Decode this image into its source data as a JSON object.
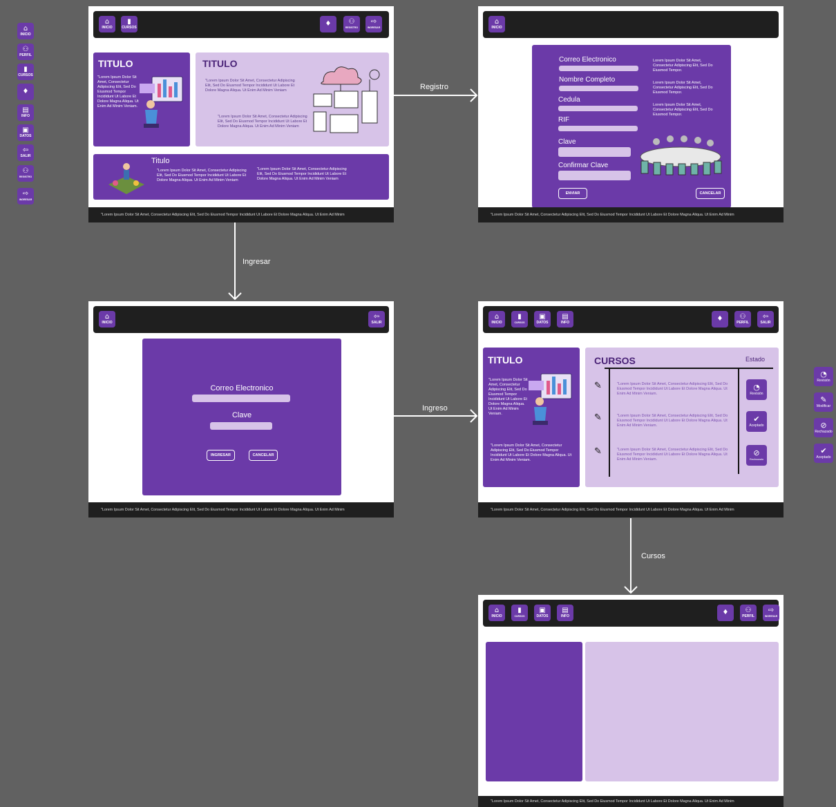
{
  "legend": [
    {
      "icon": "home-icon",
      "glyph": "⌂",
      "label": "INICIO"
    },
    {
      "icon": "user-icon",
      "glyph": "⚇",
      "label": "PERFIL"
    },
    {
      "icon": "book-icon",
      "glyph": "▮",
      "label": "CURSOS"
    },
    {
      "icon": "bell-icon",
      "glyph": "♦",
      "label": ""
    },
    {
      "icon": "document-icon",
      "glyph": "▤",
      "label": "INFO"
    },
    {
      "icon": "folder-icon",
      "glyph": "▣",
      "label": "DATOS"
    },
    {
      "icon": "logout-icon",
      "glyph": "⇦",
      "label": "SALIR"
    },
    {
      "icon": "user-add-icon",
      "glyph": "⚇",
      "label": "REGISTRO"
    },
    {
      "icon": "login-icon",
      "glyph": "⇨",
      "label": "INGRESAR"
    }
  ],
  "status_legend": [
    {
      "icon": "clock-icon",
      "glyph": "◔",
      "label": "Revisión"
    },
    {
      "icon": "wrench-icon",
      "glyph": "✎",
      "label": "Modificar"
    },
    {
      "icon": "ban-icon",
      "glyph": "⊘",
      "label": "Rechazado"
    },
    {
      "icon": "check-icon",
      "glyph": "✔",
      "label": "Aceptado"
    }
  ],
  "arrows": {
    "registro": "Registro",
    "ingresar": "Ingresar",
    "ingreso": "Ingreso",
    "cursos": "Cursos"
  },
  "nav": {
    "inicio": "INICIO",
    "cursos": "CURSOS",
    "datos": "DATOS",
    "info": "INFO",
    "perfil": "PERFIL",
    "salir": "SALIR",
    "registro": "REGISTRO",
    "ingresar": "INGRESAR"
  },
  "footer_text": "\"Lorem Ipsum Dolor Sit Amet, Consectetur Adipiscing Elit, Sed Do Eiusmod Tempor Incididunt Ut Labore Et Dolore Magna Aliqua. Ut Enim Ad Minim",
  "home": {
    "card1_title": "TITULO",
    "card1_text": "\"Lorem Ipsum Dolor Sit Amet, Consectetur Adipiscing Elit, Sed Do Eiusmod Tempor Incididunt Ut Labore Et Dolore Magna Aliqua. Ut Enim Ad Minim Veniam.",
    "card2_title": "TITULO",
    "card2_text1": "\"Lorem Ipsum Dolor Sit Amet, Consectetur Adipiscing Elit, Sed Do Eiusmod Tempor Incididunt Ut Labore Et Dolore Magna Aliqua. Ut Enim Ad Minim Veniam",
    "card2_text2": "\"Lorem Ipsum Dolor Sit Amet, Consectetur Adipiscing Elit, Sed Do Eiusmod Tempor Incididunt Ut Labore Et Dolore Magna Aliqua. Ut Enim Ad Minim Veniam",
    "card3_title": "Titulo",
    "card3_text1": "\"Lorem Ipsum Dolor Sit Amet, Consectetur Adipiscing Elit, Sed Do Eiusmod Tempor Incididunt Ut Labore Et Dolore Magna Aliqua. Ut Enim Ad Minim Veniam",
    "card3_text2": "\"Lorem Ipsum Dolor Sit Amet, Consectetur Adipiscing Elit, Sed Do Eiusmod Tempor Incididunt Ut Labore Et Dolore Magna Aliqua. Ut Enim Ad Minim Veniam"
  },
  "register": {
    "fields": [
      "Correo Electronico",
      "Nombre Completo",
      "Cedula",
      "RIF",
      "Clave",
      "Confirmar Clave"
    ],
    "notes": [
      "Lorem Ipsum Dolor Sit Amet, Consectetur Adipiscing Elit, Sed Do Eiusmod Tempor.",
      "Lorem Ipsum Dolor Sit Amet, Consectetur Adipiscing Elit, Sed Do Eiusmod Tempor.",
      "Lorem Ipsum Dolor Sit Amet, Consectetur Adipiscing Elit, Sed Do Eiusmod Tempor."
    ],
    "submit": "ENVIAR",
    "cancel": "CANCELAR"
  },
  "login": {
    "email": "Correo Electronico",
    "password": "Clave",
    "submit": "INGRESAR",
    "cancel": "CANCELAR"
  },
  "dashboard": {
    "left_title": "TITULO",
    "left_text1": "\"Lorem Ipsum Dolor Sit Amet, Consectetur Adipiscing Elit, Sed Do Eiusmod Tempor Incididunt Ut Labore Et Dolore Magna Aliqua. Ut Enim Ad Minim Veniam.",
    "left_text2": "\"Lorem Ipsum Dolor Sit Amet, Consectetur Adipiscing Elit, Sed Do Eiusmod Tempor Incididunt Ut Labore Et Dolore Magna Aliqua. Ut Enim Ad Minim Veniam.",
    "courses_title": "CURSOS",
    "status_header": "Estado",
    "rows": [
      {
        "text": "\"Lorem Ipsum Dolor Sit Amet, Consectetur Adipiscing Elit, Sed Do Eiusmod Tempor Incididunt Ut Labore Et Dolore Magna Aliqua. Ut Enim Ad Minim Veniam.",
        "status": "Revisión",
        "glyph": "◔"
      },
      {
        "text": "\"Lorem Ipsum Dolor Sit Amet, Consectetur Adipiscing Elit, Sed Do Eiusmod Tempor Incididunt Ut Labore Et Dolore Magna Aliqua. Ut Enim Ad Minim Veniam.",
        "status": "Aceptado",
        "glyph": "✔"
      },
      {
        "text": "\"Lorem Ipsum Dolor Sit Amet, Consectetur Adipiscing Elit, Sed Do Eiusmod Tempor Incididunt Ut Labore Et Dolore Magna Aliqua. Ut Enim Ad Minim Veniam.",
        "status": "Rechazado",
        "glyph": "⊘"
      }
    ]
  },
  "glyphs": {
    "home": "⌂",
    "user": "⚇",
    "book": "▮",
    "bell": "♦",
    "doc": "▤",
    "folder": "▣",
    "logout": "⇦",
    "login": "⇨",
    "edit": "✎"
  }
}
